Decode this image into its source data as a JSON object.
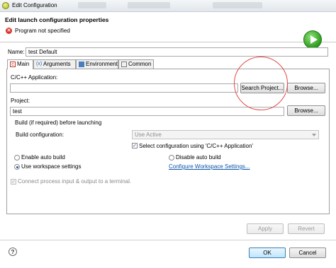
{
  "window": {
    "title": "Edit Configuration"
  },
  "banner": {
    "title": "Edit launch configuration properties",
    "error_text": "Program not specified"
  },
  "name_field": {
    "label": "Name:",
    "value": "test Default"
  },
  "tabs": [
    {
      "label": "Main",
      "icon": "main-tab-icon"
    },
    {
      "label": "Arguments",
      "icon": "arguments-icon"
    },
    {
      "label": "Environment",
      "icon": "environment-icon"
    },
    {
      "label": "Common",
      "icon": "common-icon"
    }
  ],
  "main": {
    "application_label": "C/C++ Application:",
    "application_value": "",
    "search_project_label": "Search Project...",
    "browse_label_1": "Browse...",
    "project_label": "Project:",
    "project_value": "test",
    "browse_label_2": "Browse...",
    "build_group_label": "Build (if required) before launching",
    "build_config_label": "Build configuration:",
    "build_config_value": "Use Active",
    "select_config_label": "Select configuration using 'C/C++ Application'",
    "enable_auto_build_label": "Enable auto build",
    "disable_auto_build_label": "Disable auto build",
    "use_workspace_label": "Use workspace settings",
    "configure_workspace_link": "Configure Workspace Settings...",
    "connect_process_label": "Connect process input & output to a terminal."
  },
  "actions": {
    "apply_label": "Apply",
    "revert_label": "Revert"
  },
  "footer": {
    "help_label": "?",
    "ok_label": "OK",
    "cancel_label": "Cancel"
  },
  "colors": {
    "annotation_circle": "#e04b47",
    "link": "#0a55a8",
    "error": "#d9342b"
  }
}
